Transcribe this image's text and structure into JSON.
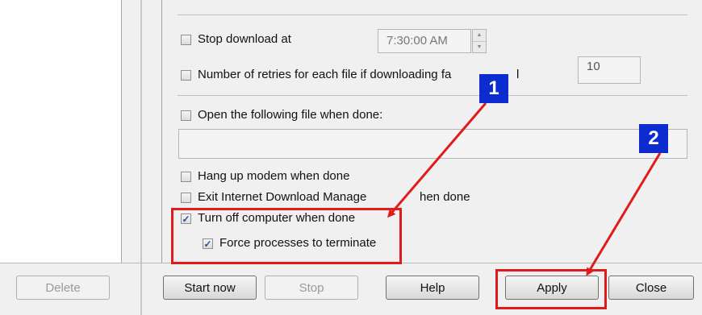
{
  "options": {
    "stop_download_label": "Stop download at",
    "stop_download_time": "7:30:00 AM",
    "retries_label": "Number of retries for each file if downloading fa",
    "retries_label_tail": "l",
    "retries_value": "10",
    "open_file_label": "Open the following file when done:",
    "open_file_value": "",
    "hang_up_label": "Hang up modem when done",
    "exit_idm_label": "Exit Internet Download Manage",
    "exit_idm_tail": "hen done",
    "turn_off_label": "Turn off computer when done",
    "force_label": "Force processes to terminate"
  },
  "checkboxes": {
    "stop_download": false,
    "retries": false,
    "open_file": false,
    "hang_up": false,
    "exit_idm": false,
    "turn_off": true,
    "force": true
  },
  "buttons": {
    "delete": "Delete",
    "start_now": "Start now",
    "stop": "Stop",
    "help": "Help",
    "apply": "Apply",
    "close": "Close"
  },
  "annotations": {
    "step1": "1",
    "step2": "2",
    "highlight_color": "#e01b1b",
    "badge_color": "#0c2ccf"
  }
}
